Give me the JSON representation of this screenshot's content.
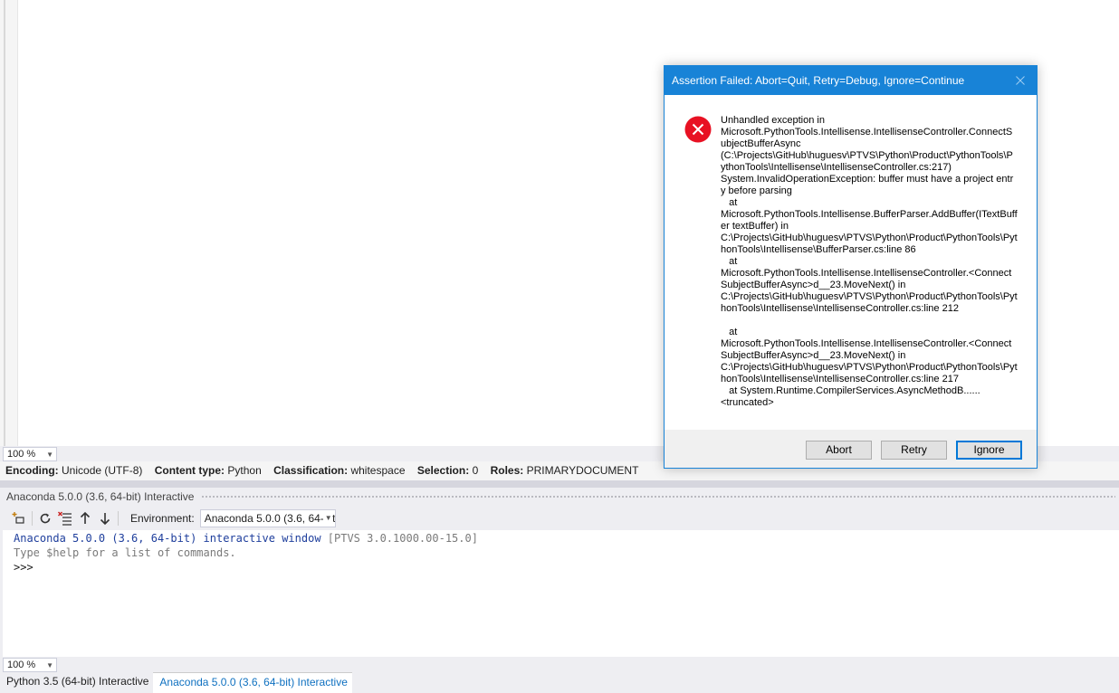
{
  "editor": {
    "zoom": "100 %"
  },
  "infobar": {
    "encoding_label": "Encoding:",
    "encoding_value": "Unicode (UTF-8)",
    "content_label": "Content type:",
    "content_value": "Python",
    "classification_label": "Classification:",
    "classification_value": "whitespace",
    "selection_label": "Selection:",
    "selection_value": "0",
    "roles_label": "Roles:",
    "roles_value": "PRIMARYDOCUMENT"
  },
  "interactive": {
    "title": "Anaconda 5.0.0 (3.6, 64-bit) Interactive",
    "environment_label": "Environment:",
    "environment_value": "Anaconda 5.0.0 (3.6, 64-bit)",
    "line1_main": "Anaconda 5.0.0 (3.6, 64-bit) interactive window ",
    "line1_version": "[PTVS 3.0.1000.00-15.0]",
    "line2": "Type $help for a list of commands.",
    "prompt": ">>>",
    "zoom": "100 %"
  },
  "tabs": [
    {
      "label": "Python 3.5 (64-bit) Interactive"
    },
    {
      "label": "Anaconda 5.0.0 (3.6, 64-bit) Interactive"
    }
  ],
  "dialog": {
    "title": "Assertion Failed: Abort=Quit, Retry=Debug, Ignore=Continue",
    "message": "Unhandled exception in\nMicrosoft.PythonTools.Intellisense.IntellisenseController.ConnectSubjectBufferAsync\n(C:\\Projects\\GitHub\\huguesv\\PTVS\\Python\\Product\\PythonTools\\PythonTools\\Intellisense\\IntellisenseController.cs:217)\nSystem.InvalidOperationException: buffer must have a project entry before parsing\n   at\nMicrosoft.PythonTools.Intellisense.BufferParser.AddBuffer(ITextBuffer textBuffer) in\nC:\\Projects\\GitHub\\huguesv\\PTVS\\Python\\Product\\PythonTools\\PythonTools\\Intellisense\\BufferParser.cs:line 86\n   at\nMicrosoft.PythonTools.Intellisense.IntellisenseController.<ConnectSubjectBufferAsync>d__23.MoveNext() in\nC:\\Projects\\GitHub\\huguesv\\PTVS\\Python\\Product\\PythonTools\\PythonTools\\Intellisense\\IntellisenseController.cs:line 212\n\n   at\nMicrosoft.PythonTools.Intellisense.IntellisenseController.<ConnectSubjectBufferAsync>d__23.MoveNext() in\nC:\\Projects\\GitHub\\huguesv\\PTVS\\Python\\Product\\PythonTools\\PythonTools\\Intellisense\\IntellisenseController.cs:line 217\n   at System.Runtime.CompilerServices.AsyncMethodB......\n<truncated>",
    "abort_label": "Abort",
    "retry_label": "Retry",
    "ignore_label": "Ignore"
  },
  "colors": {
    "dialog_accent": "#1883d7",
    "error_red": "#e81123",
    "link_blue": "#0e70c0"
  }
}
